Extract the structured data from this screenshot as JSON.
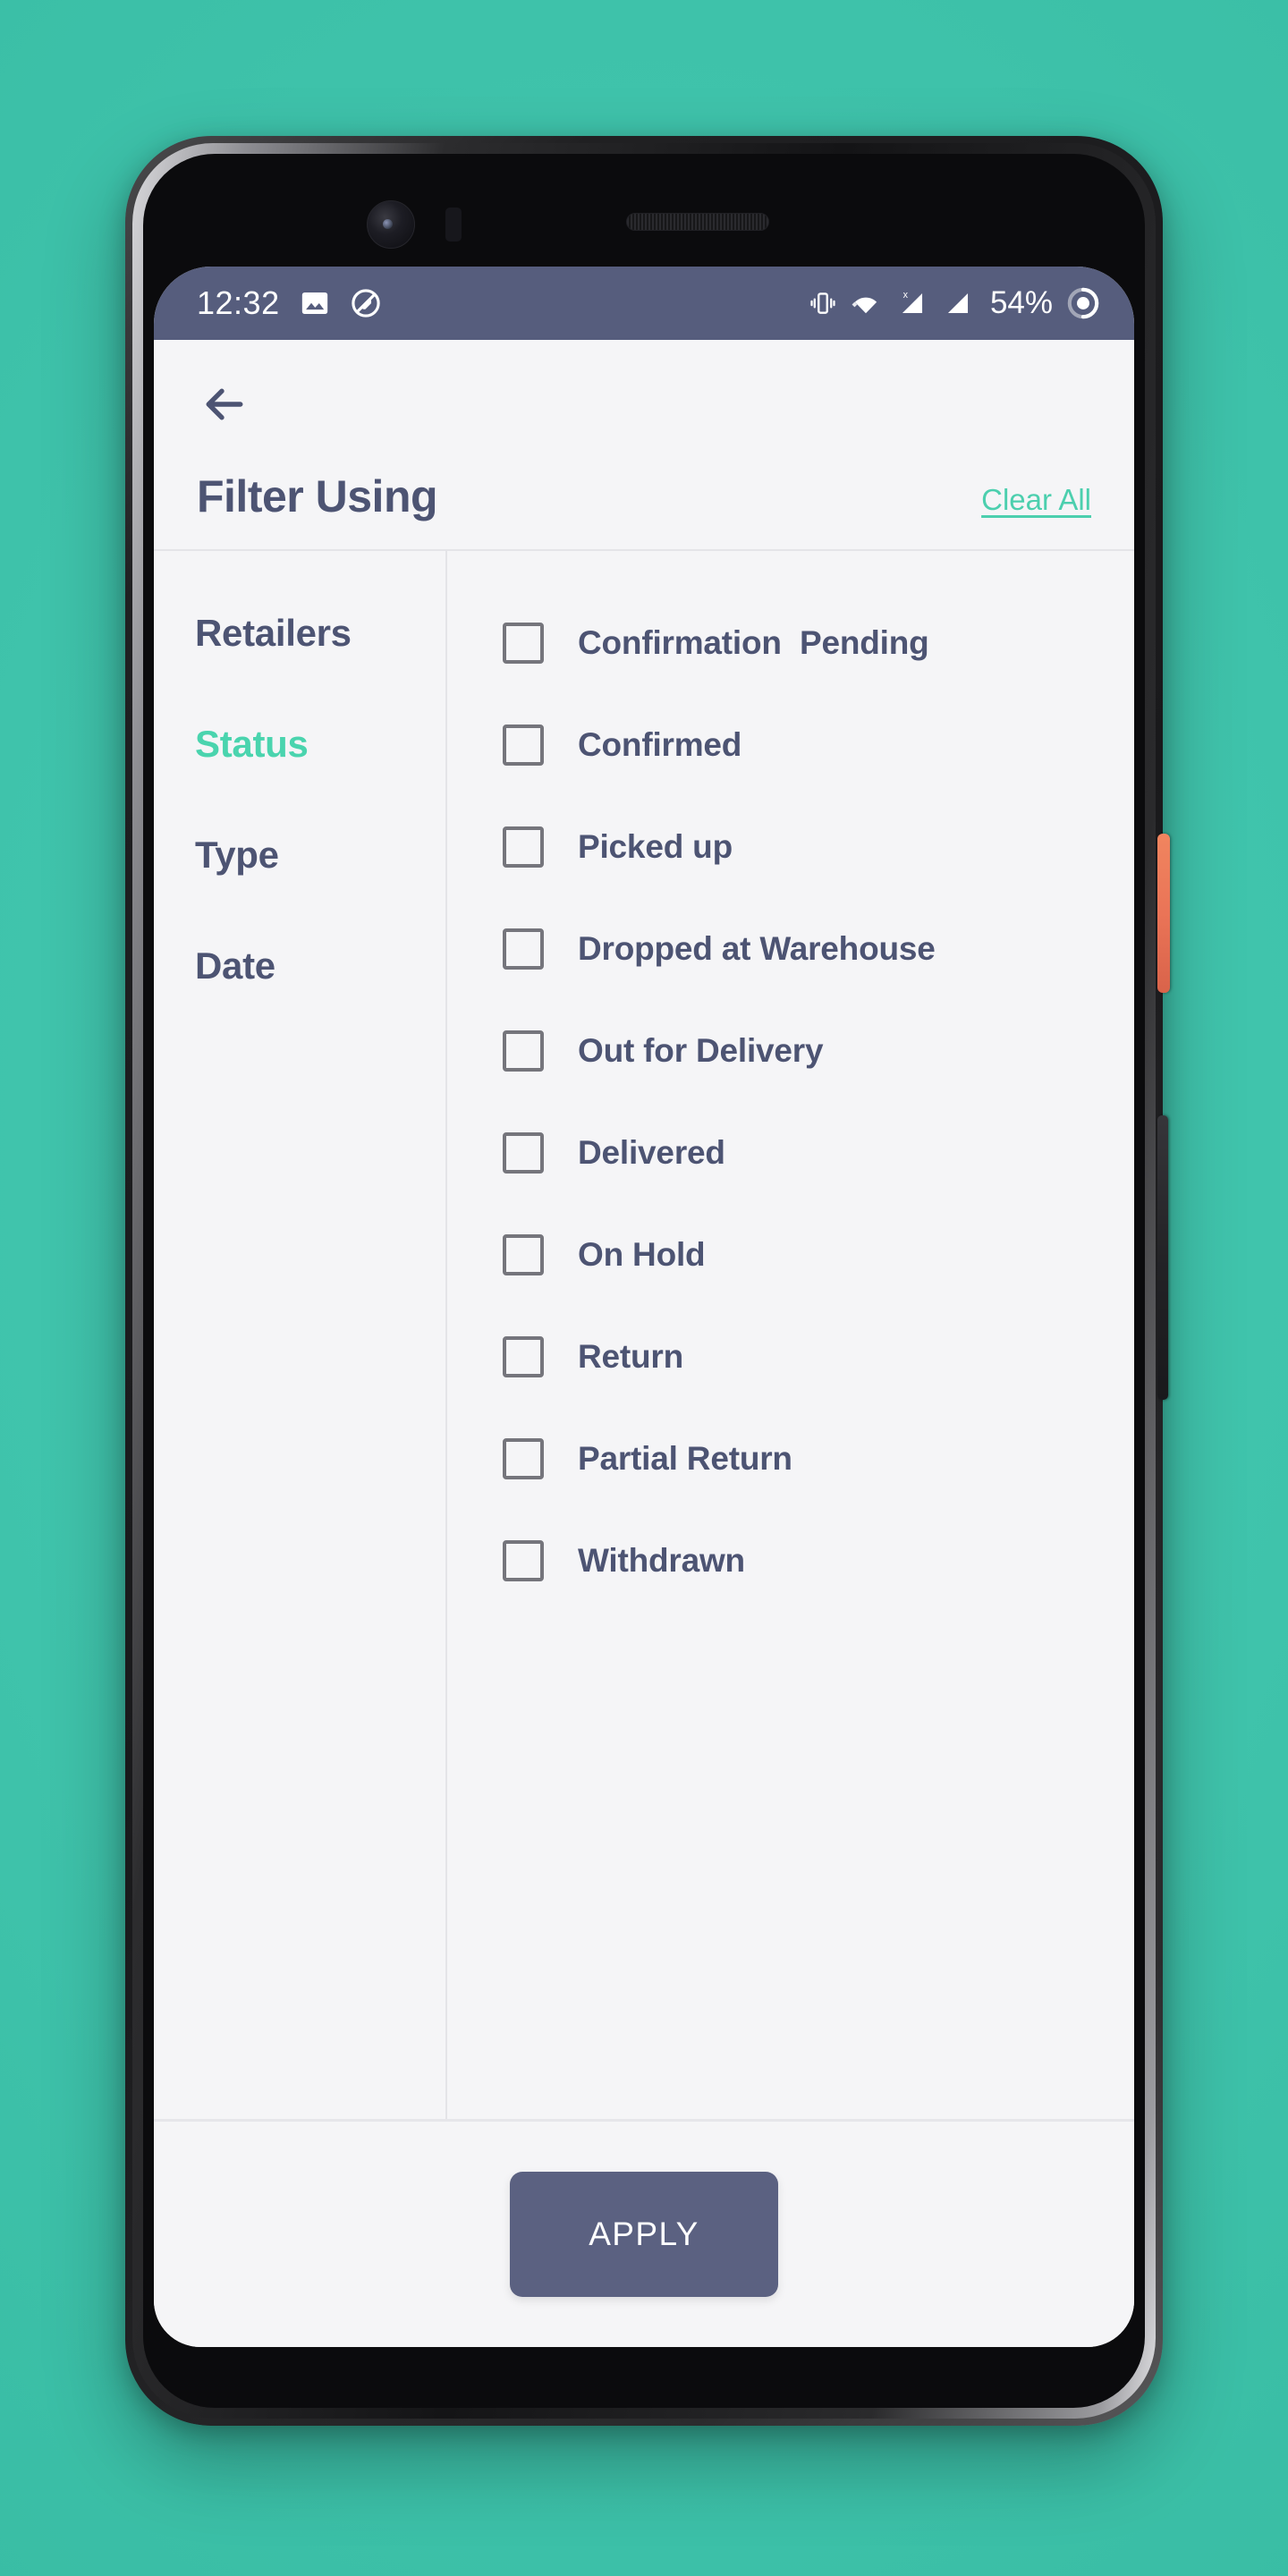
{
  "status_bar": {
    "time": "12:32",
    "battery_percent": "54%",
    "left_icons": [
      "image-icon",
      "do-not-disturb-icon"
    ],
    "right_icons": [
      "vibrate-icon",
      "wifi-icon",
      "signal-no-sim-icon",
      "signal-icon",
      "battery-circle-icon"
    ],
    "background_color": "#565d7d"
  },
  "app_bar": {
    "back_icon": "arrow-left-icon",
    "title": "Filter Using",
    "clear_all_label": "Clear All",
    "clear_all_color": "#4ccfae"
  },
  "sidebar": {
    "items": [
      {
        "label": "Retailers",
        "active": false
      },
      {
        "label": "Status",
        "active": true
      },
      {
        "label": "Type",
        "active": false
      },
      {
        "label": "Date",
        "active": false
      }
    ],
    "active_color": "#4ad4ae",
    "inactive_color": "#4d5473"
  },
  "options": {
    "items": [
      {
        "label": "Confirmation  Pending",
        "checked": false
      },
      {
        "label": "Confirmed",
        "checked": false
      },
      {
        "label": "Picked up",
        "checked": false
      },
      {
        "label": "Dropped at Warehouse",
        "checked": false
      },
      {
        "label": "Out for Delivery",
        "checked": false
      },
      {
        "label": "Delivered",
        "checked": false
      },
      {
        "label": "On Hold",
        "checked": false
      },
      {
        "label": "Return",
        "checked": false
      },
      {
        "label": "Partial Return",
        "checked": false
      },
      {
        "label": "Withdrawn",
        "checked": false
      }
    ]
  },
  "footer": {
    "apply_label": "APPLY",
    "apply_color": "#5b6181"
  },
  "device": {
    "power_button_color": "#ea7457",
    "volume_button_color": "#232326",
    "background_color": "#3fc3ab"
  }
}
